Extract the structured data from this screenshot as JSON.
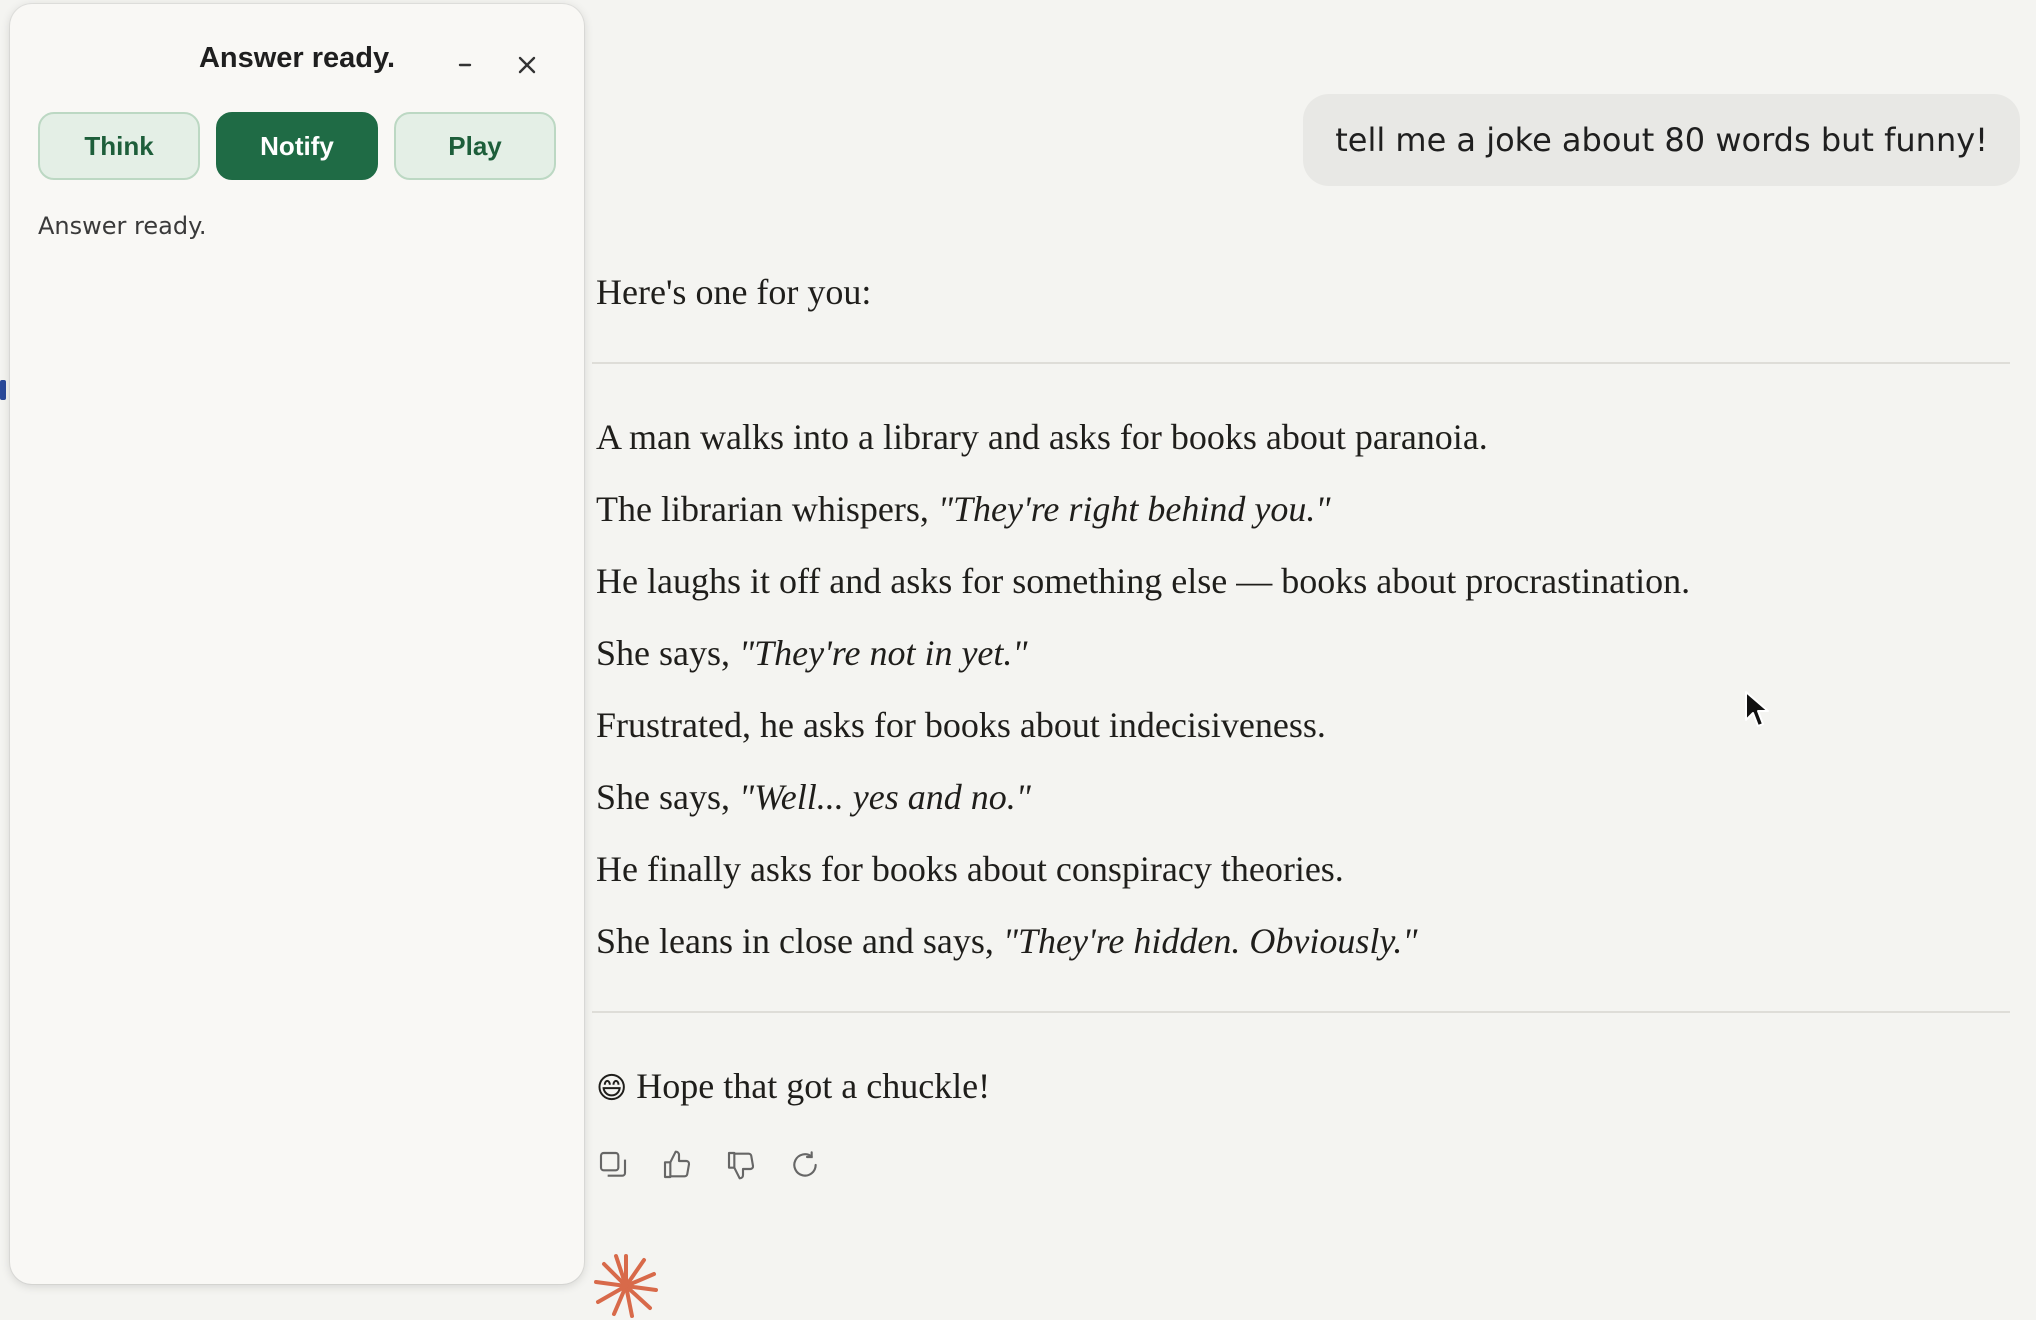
{
  "colors": {
    "background": "#f4f4f1",
    "panel": "#f9f8f5",
    "accent_dark": "#1f6b45",
    "accent_light": "#e4efe6",
    "user_bubble": "#e8e8e5",
    "spark": "#d86a4a"
  },
  "panel": {
    "title": "Answer ready.",
    "minimize_icon": "minimize-icon",
    "close_icon": "close-icon",
    "buttons": {
      "think": "Think",
      "notify": "Notify",
      "play": "Play"
    },
    "status": "Answer ready."
  },
  "chat": {
    "user_message": "tell me a joke about 80 words but funny!",
    "intro": "Here's one for you:",
    "lines": [
      {
        "plain": "A man walks into a library and asks for books about paranoia.",
        "quote": ""
      },
      {
        "plain": "The librarian whispers, ",
        "quote": "\"They're right behind you.\""
      },
      {
        "plain": "He laughs it off and asks for something else — books about procrastination.",
        "quote": ""
      },
      {
        "plain": "She says, ",
        "quote": "\"They're not in yet.\""
      },
      {
        "plain": "Frustrated, he asks for books about indecisiveness.",
        "quote": ""
      },
      {
        "plain": "She says, ",
        "quote": "\"Well... yes and no.\""
      },
      {
        "plain": "He finally asks for books about conspiracy theories.",
        "quote": ""
      },
      {
        "plain": "She leans in close and says, ",
        "quote": "\"They're hidden. Obviously.\""
      }
    ],
    "closing_emoji": "😄",
    "closing": "Hope that got a chuckle!",
    "actions": [
      "copy-icon",
      "thumbs-up-icon",
      "thumbs-down-icon",
      "retry-icon"
    ]
  }
}
